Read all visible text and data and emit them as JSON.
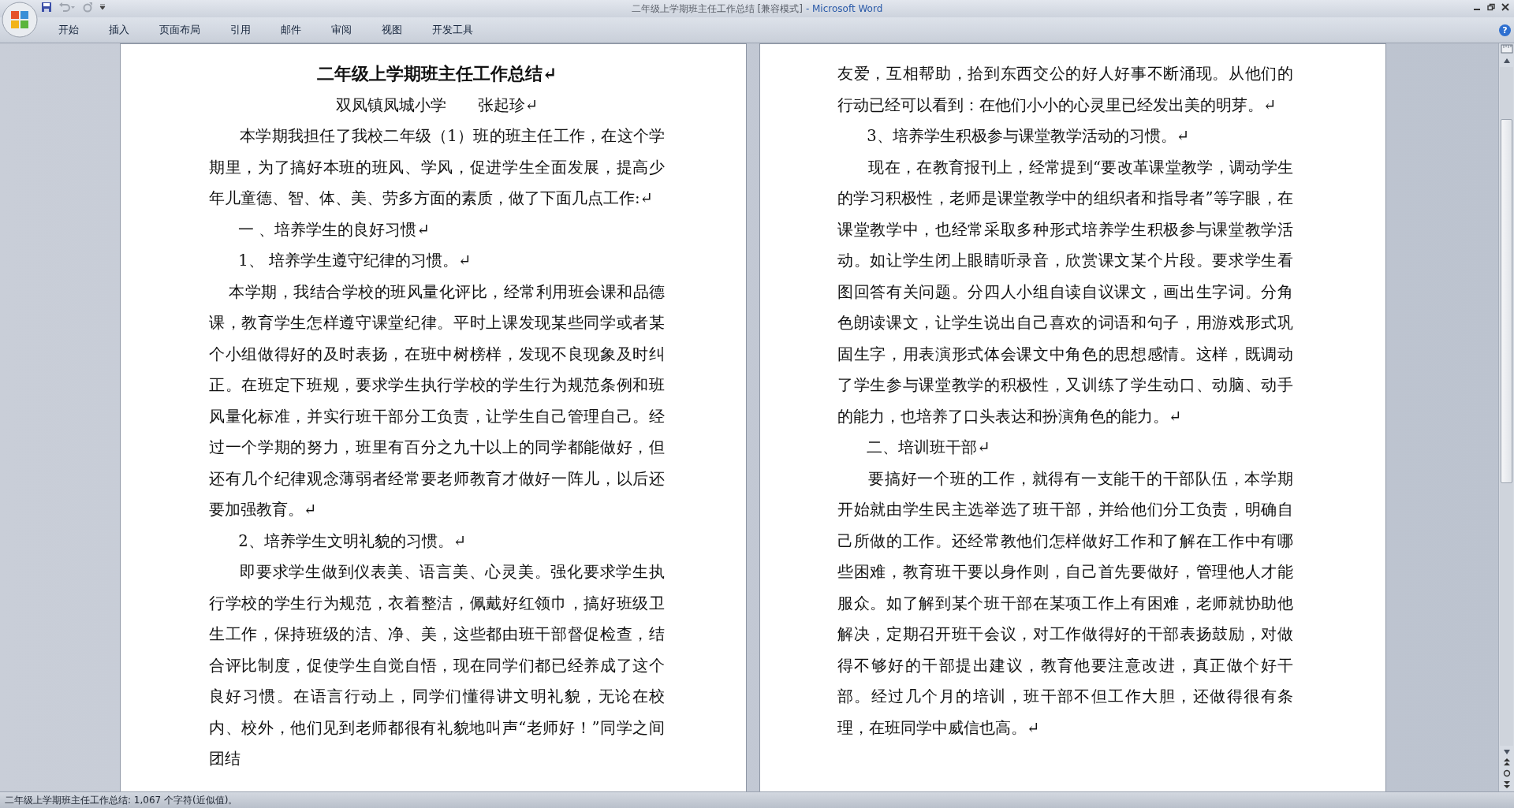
{
  "window": {
    "title": "二年级上学期班主任工作总结 [兼容模式]",
    "app": "- Microsoft Word",
    "help": "?"
  },
  "ribbon_tabs": [
    {
      "label": "开始",
      "selected": false
    },
    {
      "label": "插入",
      "selected": false
    },
    {
      "label": "页面布局",
      "selected": false
    },
    {
      "label": "引用",
      "selected": false
    },
    {
      "label": "邮件",
      "selected": false
    },
    {
      "label": "审阅",
      "selected": false
    },
    {
      "label": "视图",
      "selected": false
    },
    {
      "label": "开发工具",
      "selected": false
    }
  ],
  "pages": [
    {
      "paragraphs": [
        {
          "kind": "title",
          "text": "二年级上学期班主任工作总结↵"
        },
        {
          "kind": "subtitle",
          "text": "双凤镇凤城小学　　张起珍↵"
        },
        {
          "kind": "body",
          "text": "本学期我担任了我校二年级（1）班的班主任工作，在这个学期里，为了搞好本班的班风、学风，促进学生全面发展，提高少年儿童德、智、体、美、劳多方面的素质，做了下面几点工作:↵"
        },
        {
          "kind": "heading",
          "text": "一 、培养学生的良好习惯↵"
        },
        {
          "kind": "heading",
          "text": "1、  培养学生遵守纪律的习惯。↵"
        },
        {
          "kind": "body2",
          "text": "本学期，我结合学校的班风量化评比，经常利用班会课和品德课，教育学生怎样遵守课堂纪律。平时上课发现某些同学或者某个小组做得好的及时表扬，在班中树榜样，发现不良现象及时纠正。在班定下班规，要求学生执行学校的学生行为规范条例和班风量化标准，并实行班干部分工负责，让学生自己管理自己。经过一个学期的努力，班里有百分之九十以上的同学都能做好，但还有几个纪律观念薄弱者经常要老师教育才做好一阵儿，以后还要加强教育。↵"
        },
        {
          "kind": "heading",
          "text": "2、培养学生文明礼貌的习惯。↵"
        },
        {
          "kind": "body",
          "text": "即要求学生做到仪表美、语言美、心灵美。强化要求学生执行学校的学生行为规范，衣着整洁，佩戴好红领巾，搞好班级卫生工作，保持班级的洁、净、美，这些都由班干部督促检查，结合评比制度，促使学生自觉自悟，现在同学们都已经养成了这个良好习惯。在语言行动上，同学们懂得讲文明礼貌，无论在校内、校外，他们见到老师都很有礼貌地叫声“老师好！”同学之间团结"
        }
      ]
    },
    {
      "paragraphs": [
        {
          "kind": "continued",
          "text": "友爱，互相帮助，拾到东西交公的好人好事不断涌现。从他们的行动已经可以看到：在他们小小的心灵里已经发出美的明芽。↵"
        },
        {
          "kind": "heading",
          "text": "3、培养学生积极参与课堂教学活动的习惯。↵"
        },
        {
          "kind": "body",
          "text": "现在，在教育报刊上，经常提到“要改革课堂教学，调动学生的学习积极性，老师是课堂教学中的组织者和指导者”等字眼，在课堂教学中，也经常采取多种形式培养学生积极参与课堂教学活动。如让学生闭上眼睛听录音，欣赏课文某个片段。要求学生看图回答有关问题。分四人小组自读自议课文，画出生字词。分角色朗读课文，让学生说出自己喜欢的词语和句子，用游戏形式巩固生字，用表演形式体会课文中角色的思想感情。这样，既调动了学生参与课堂教学的积极性，又训练了学生动口、动脑、动手的能力，也培养了口头表达和扮演角色的能力。↵"
        },
        {
          "kind": "heading",
          "text": "二、培训班干部↵"
        },
        {
          "kind": "body",
          "text": "要搞好一个班的工作，就得有一支能干的干部队伍，本学期开始就由学生民主选举选了班干部，并给他们分工负责，明确自己所做的工作。还经常教他们怎样做好工作和了解在工作中有哪些困难，教育班干要以身作则，自己首先要做好，管理他人才能服众。如了解到某个班干部在某项工作上有困难，老师就协助他解决，定期召开班干会议，对工作做得好的干部表扬鼓励，对做得不够好的干部提出建议，教育他要注意改进，真正做个好干部。经过几个月的培训，班干部不但工作大胆，还做得很有条理，在班同学中威信也高。↵"
        }
      ]
    }
  ],
  "status_bar": {
    "text": "二年级上学期班主任工作总结: 1,067 个字符(近似值)。"
  }
}
